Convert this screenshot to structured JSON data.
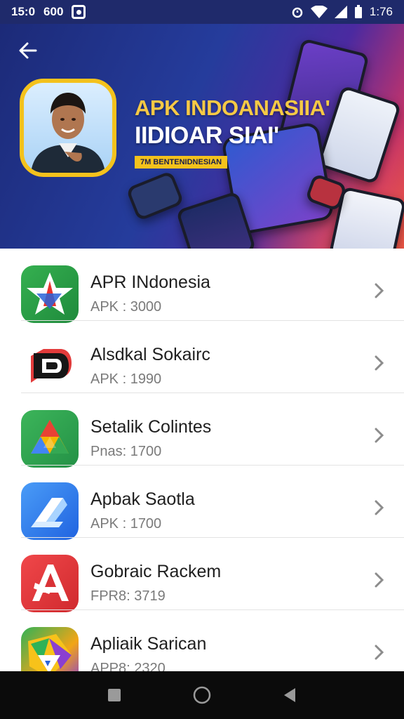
{
  "status_bar": {
    "time": "15:0",
    "extra": "600",
    "battery": "1:76"
  },
  "header": {
    "back_label": "",
    "title": "APK INDOANASIIA'",
    "subtitle": "IIDIOAR SIAI'",
    "tagline": "7M BENTENIDNESIAN"
  },
  "apps": [
    {
      "name": "APR INdonesia",
      "meta": "APK : 3000",
      "icon": "star-a-icon",
      "color": "#2ea44f"
    },
    {
      "name": "Alsdkal Sokairc",
      "meta": "APK : 1990",
      "icon": "d-logo-icon",
      "color": "#111111"
    },
    {
      "name": "Setalik Colintes",
      "meta": "Pnas: 1700",
      "icon": "triangle-drive-icon",
      "color": "#34a853"
    },
    {
      "name": "Apbak Saotla",
      "meta": "APK : 1700",
      "icon": "blue-arrow-icon",
      "color": "#2d7ff0"
    },
    {
      "name": "Gobraic Rackem",
      "meta": "FPR8: 3719",
      "icon": "red-a-icon",
      "color": "#e23a3a"
    },
    {
      "name": "Apliaik Sarican",
      "meta": "APP8: 2320",
      "icon": "colorful-a-icon",
      "color": "#f2a516"
    }
  ],
  "nav_bar": {
    "recents": "square-icon",
    "home": "circle-icon",
    "back": "triangle-back-icon"
  }
}
